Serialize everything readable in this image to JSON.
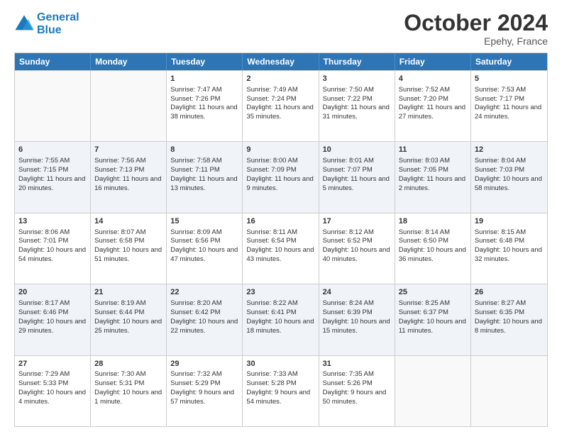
{
  "header": {
    "logo_general": "General",
    "logo_blue": "Blue",
    "month": "October 2024",
    "location": "Epehy, France"
  },
  "days": [
    "Sunday",
    "Monday",
    "Tuesday",
    "Wednesday",
    "Thursday",
    "Friday",
    "Saturday"
  ],
  "weeks": [
    [
      {
        "day": "",
        "sunrise": "",
        "sunset": "",
        "daylight": "",
        "empty": true
      },
      {
        "day": "",
        "sunrise": "",
        "sunset": "",
        "daylight": "",
        "empty": true
      },
      {
        "day": "1",
        "sunrise": "Sunrise: 7:47 AM",
        "sunset": "Sunset: 7:26 PM",
        "daylight": "Daylight: 11 hours and 38 minutes."
      },
      {
        "day": "2",
        "sunrise": "Sunrise: 7:49 AM",
        "sunset": "Sunset: 7:24 PM",
        "daylight": "Daylight: 11 hours and 35 minutes."
      },
      {
        "day": "3",
        "sunrise": "Sunrise: 7:50 AM",
        "sunset": "Sunset: 7:22 PM",
        "daylight": "Daylight: 11 hours and 31 minutes."
      },
      {
        "day": "4",
        "sunrise": "Sunrise: 7:52 AM",
        "sunset": "Sunset: 7:20 PM",
        "daylight": "Daylight: 11 hours and 27 minutes."
      },
      {
        "day": "5",
        "sunrise": "Sunrise: 7:53 AM",
        "sunset": "Sunset: 7:17 PM",
        "daylight": "Daylight: 11 hours and 24 minutes."
      }
    ],
    [
      {
        "day": "6",
        "sunrise": "Sunrise: 7:55 AM",
        "sunset": "Sunset: 7:15 PM",
        "daylight": "Daylight: 11 hours and 20 minutes."
      },
      {
        "day": "7",
        "sunrise": "Sunrise: 7:56 AM",
        "sunset": "Sunset: 7:13 PM",
        "daylight": "Daylight: 11 hours and 16 minutes."
      },
      {
        "day": "8",
        "sunrise": "Sunrise: 7:58 AM",
        "sunset": "Sunset: 7:11 PM",
        "daylight": "Daylight: 11 hours and 13 minutes."
      },
      {
        "day": "9",
        "sunrise": "Sunrise: 8:00 AM",
        "sunset": "Sunset: 7:09 PM",
        "daylight": "Daylight: 11 hours and 9 minutes."
      },
      {
        "day": "10",
        "sunrise": "Sunrise: 8:01 AM",
        "sunset": "Sunset: 7:07 PM",
        "daylight": "Daylight: 11 hours and 5 minutes."
      },
      {
        "day": "11",
        "sunrise": "Sunrise: 8:03 AM",
        "sunset": "Sunset: 7:05 PM",
        "daylight": "Daylight: 11 hours and 2 minutes."
      },
      {
        "day": "12",
        "sunrise": "Sunrise: 8:04 AM",
        "sunset": "Sunset: 7:03 PM",
        "daylight": "Daylight: 10 hours and 58 minutes."
      }
    ],
    [
      {
        "day": "13",
        "sunrise": "Sunrise: 8:06 AM",
        "sunset": "Sunset: 7:01 PM",
        "daylight": "Daylight: 10 hours and 54 minutes."
      },
      {
        "day": "14",
        "sunrise": "Sunrise: 8:07 AM",
        "sunset": "Sunset: 6:58 PM",
        "daylight": "Daylight: 10 hours and 51 minutes."
      },
      {
        "day": "15",
        "sunrise": "Sunrise: 8:09 AM",
        "sunset": "Sunset: 6:56 PM",
        "daylight": "Daylight: 10 hours and 47 minutes."
      },
      {
        "day": "16",
        "sunrise": "Sunrise: 8:11 AM",
        "sunset": "Sunset: 6:54 PM",
        "daylight": "Daylight: 10 hours and 43 minutes."
      },
      {
        "day": "17",
        "sunrise": "Sunrise: 8:12 AM",
        "sunset": "Sunset: 6:52 PM",
        "daylight": "Daylight: 10 hours and 40 minutes."
      },
      {
        "day": "18",
        "sunrise": "Sunrise: 8:14 AM",
        "sunset": "Sunset: 6:50 PM",
        "daylight": "Daylight: 10 hours and 36 minutes."
      },
      {
        "day": "19",
        "sunrise": "Sunrise: 8:15 AM",
        "sunset": "Sunset: 6:48 PM",
        "daylight": "Daylight: 10 hours and 32 minutes."
      }
    ],
    [
      {
        "day": "20",
        "sunrise": "Sunrise: 8:17 AM",
        "sunset": "Sunset: 6:46 PM",
        "daylight": "Daylight: 10 hours and 29 minutes."
      },
      {
        "day": "21",
        "sunrise": "Sunrise: 8:19 AM",
        "sunset": "Sunset: 6:44 PM",
        "daylight": "Daylight: 10 hours and 25 minutes."
      },
      {
        "day": "22",
        "sunrise": "Sunrise: 8:20 AM",
        "sunset": "Sunset: 6:42 PM",
        "daylight": "Daylight: 10 hours and 22 minutes."
      },
      {
        "day": "23",
        "sunrise": "Sunrise: 8:22 AM",
        "sunset": "Sunset: 6:41 PM",
        "daylight": "Daylight: 10 hours and 18 minutes."
      },
      {
        "day": "24",
        "sunrise": "Sunrise: 8:24 AM",
        "sunset": "Sunset: 6:39 PM",
        "daylight": "Daylight: 10 hours and 15 minutes."
      },
      {
        "day": "25",
        "sunrise": "Sunrise: 8:25 AM",
        "sunset": "Sunset: 6:37 PM",
        "daylight": "Daylight: 10 hours and 11 minutes."
      },
      {
        "day": "26",
        "sunrise": "Sunrise: 8:27 AM",
        "sunset": "Sunset: 6:35 PM",
        "daylight": "Daylight: 10 hours and 8 minutes."
      }
    ],
    [
      {
        "day": "27",
        "sunrise": "Sunrise: 7:29 AM",
        "sunset": "Sunset: 5:33 PM",
        "daylight": "Daylight: 10 hours and 4 minutes."
      },
      {
        "day": "28",
        "sunrise": "Sunrise: 7:30 AM",
        "sunset": "Sunset: 5:31 PM",
        "daylight": "Daylight: 10 hours and 1 minute."
      },
      {
        "day": "29",
        "sunrise": "Sunrise: 7:32 AM",
        "sunset": "Sunset: 5:29 PM",
        "daylight": "Daylight: 9 hours and 57 minutes."
      },
      {
        "day": "30",
        "sunrise": "Sunrise: 7:33 AM",
        "sunset": "Sunset: 5:28 PM",
        "daylight": "Daylight: 9 hours and 54 minutes."
      },
      {
        "day": "31",
        "sunrise": "Sunrise: 7:35 AM",
        "sunset": "Sunset: 5:26 PM",
        "daylight": "Daylight: 9 hours and 50 minutes."
      },
      {
        "day": "",
        "sunrise": "",
        "sunset": "",
        "daylight": "",
        "empty": true
      },
      {
        "day": "",
        "sunrise": "",
        "sunset": "",
        "daylight": "",
        "empty": true
      }
    ]
  ]
}
